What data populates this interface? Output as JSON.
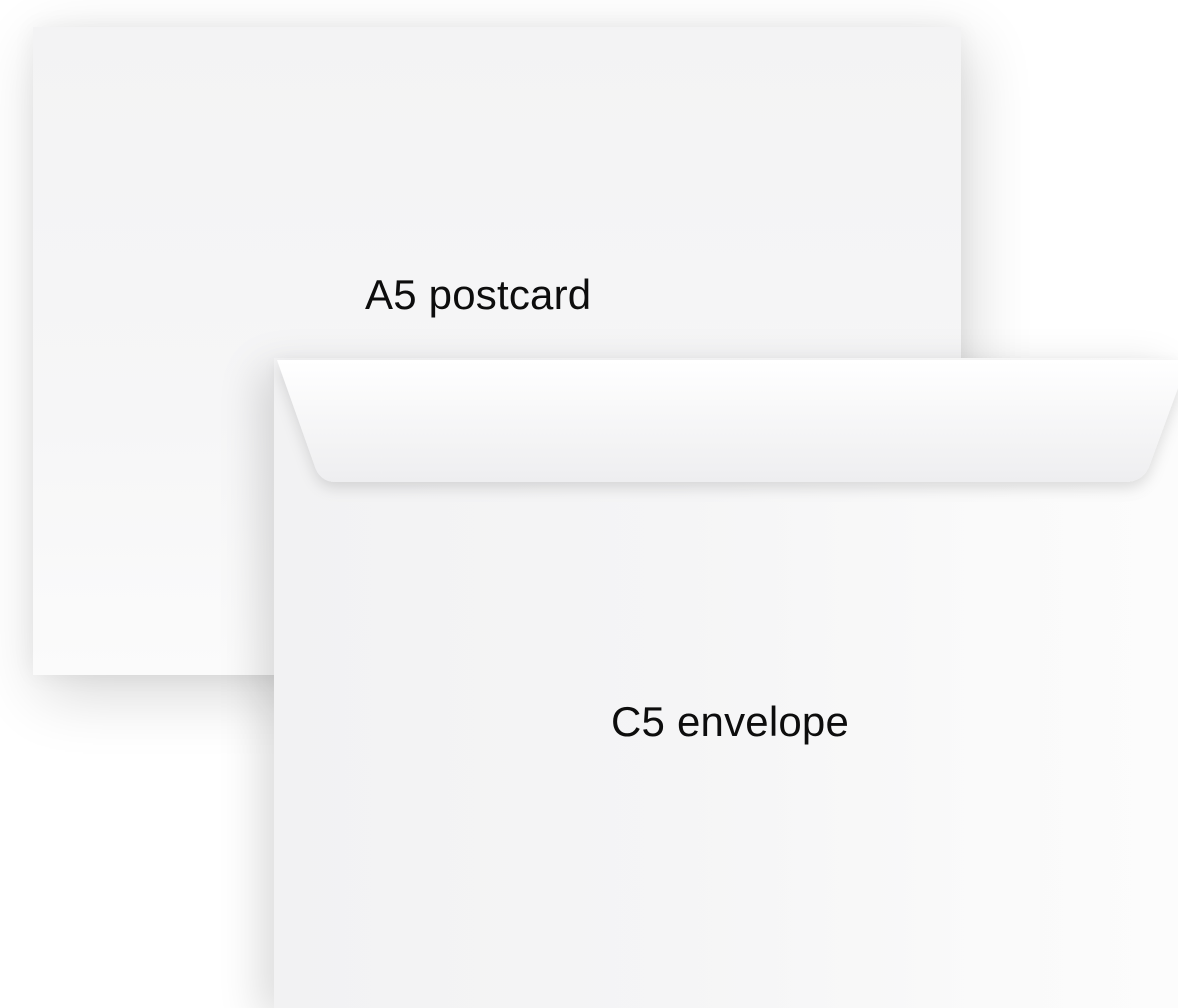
{
  "postcard": {
    "label": "A5 postcard"
  },
  "envelope": {
    "label": "C5 envelope"
  },
  "colors": {
    "background": "#ffffff",
    "paper": "#f4f4f5",
    "text": "#0d0d0d"
  }
}
